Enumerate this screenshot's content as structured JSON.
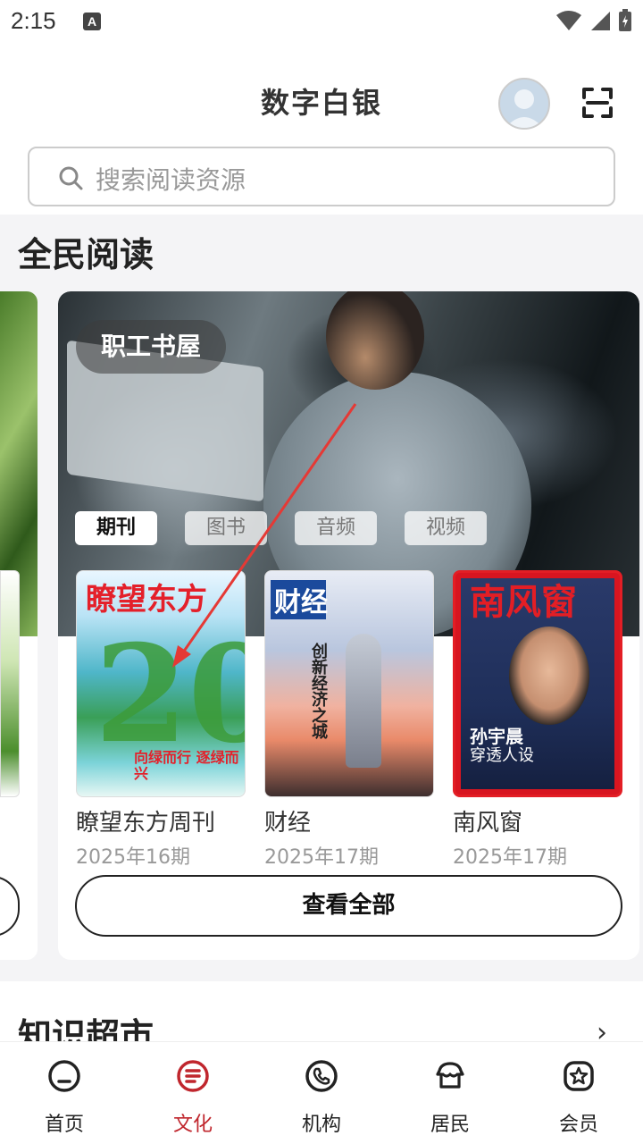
{
  "status_bar": {
    "time": "2:15",
    "notification_icon": "A"
  },
  "header": {
    "title": "数字白银"
  },
  "search": {
    "placeholder": "搜索阅读资源"
  },
  "section": {
    "title": "全民阅读"
  },
  "hero": {
    "badge": "职工书屋"
  },
  "tabs": [
    {
      "label": "期刊",
      "active": true
    },
    {
      "label": "图书",
      "active": false
    },
    {
      "label": "音频",
      "active": false
    },
    {
      "label": "视频",
      "active": false
    }
  ],
  "magazines": [
    {
      "cover_text": "瞭望东方",
      "cover_tag": "向绿而行 逐绿而兴",
      "title": "瞭望东方周刊",
      "issue": "2025年16期"
    },
    {
      "cover_text": "财经",
      "cover_tag": "创新经济之城",
      "title": "财经",
      "issue": "2025年17期"
    },
    {
      "cover_text": "南风窗",
      "cover_tag": "孙宇晨",
      "cover_sub": "穿透人设",
      "title": "南风窗",
      "issue": "2025年17期"
    }
  ],
  "view_all": "查看全部",
  "knowledge": {
    "title": "知识超市"
  },
  "nav": [
    {
      "label": "首页",
      "icon": "home-icon",
      "active": false
    },
    {
      "label": "文化",
      "icon": "culture-icon",
      "active": true
    },
    {
      "label": "机构",
      "icon": "phone-icon",
      "active": false
    },
    {
      "label": "居民",
      "icon": "resident-icon",
      "active": false
    },
    {
      "label": "会员",
      "icon": "member-icon",
      "active": false
    }
  ],
  "colors": {
    "accent": "#c0262d",
    "background": "#f4f4f6"
  }
}
